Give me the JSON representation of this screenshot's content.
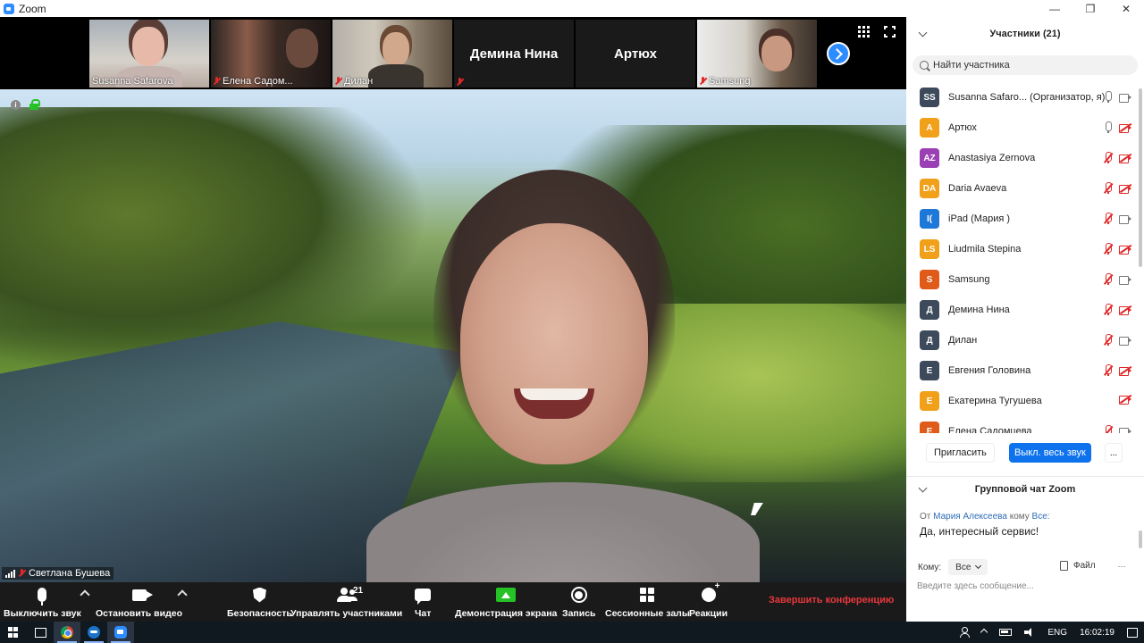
{
  "window": {
    "title": "Zoom",
    "controls": {
      "minimize": "—",
      "maximize": "❐",
      "close": "✕"
    }
  },
  "thumbnails": [
    {
      "name": "Susanna Safarova",
      "muted": false
    },
    {
      "name": "Елена Садом...",
      "muted": true
    },
    {
      "name": "Дилан",
      "muted": true
    },
    {
      "name": "Демина Нина",
      "muted": true,
      "video_off": true
    },
    {
      "name": "Артюх",
      "muted": false,
      "video_off": true
    },
    {
      "name": "Samsung",
      "muted": true
    }
  ],
  "active_speaker": {
    "name": "Светлана Бушева"
  },
  "toolbar": {
    "mute_label": "Выключить звук",
    "video_label": "Остановить видео",
    "security_label": "Безопасность",
    "participants_label": "Управлять участниками",
    "participants_count": "21",
    "chat_label": "Чат",
    "share_label": "Демонстрация экрана",
    "record_label": "Запись",
    "rooms_label": "Сессионные залы",
    "reactions_label": "Реакции",
    "end_label": "Завершить конференцию"
  },
  "participants_panel": {
    "title": "Участники (21)",
    "search_placeholder": "Найти участника",
    "participants": [
      {
        "initials": "SS",
        "name": "Susanna Safaro... (Организатор, я)",
        "color": "#3c4a5c",
        "mic_off": false,
        "cam_off": false
      },
      {
        "initials": "А",
        "name": "Артюх",
        "color": "#f0a019",
        "mic_off": false,
        "cam_off": true
      },
      {
        "initials": "AZ",
        "name": "Anastasiya Zernova",
        "color": "#9b3fb5",
        "mic_off": true,
        "cam_off": true
      },
      {
        "initials": "DA",
        "name": "Daria Avaeva",
        "color": "#f0a019",
        "mic_off": true,
        "cam_off": true
      },
      {
        "initials": "I(",
        "name": "iPad (Мария )",
        "color": "#1e78d7",
        "mic_off": true,
        "cam_off": false
      },
      {
        "initials": "LS",
        "name": "Liudmila Stepina",
        "color": "#f0a019",
        "mic_off": true,
        "cam_off": true
      },
      {
        "initials": "S",
        "name": "Samsung",
        "color": "#e05a1a",
        "mic_off": true,
        "cam_off": false
      },
      {
        "initials": "Д",
        "name": "Демина Нина",
        "color": "#3c4a5c",
        "mic_off": true,
        "cam_off": true
      },
      {
        "initials": "Д",
        "name": "Дилан",
        "color": "#3c4a5c",
        "mic_off": true,
        "cam_off": false
      },
      {
        "initials": "Е",
        "name": "Евгения Головина",
        "color": "#3c4a5c",
        "mic_off": true,
        "cam_off": true
      },
      {
        "initials": "Е",
        "name": "Екатерина Тугушева",
        "color": "#f0a019",
        "mic_off": false,
        "cam_off": true,
        "no_mic": true
      },
      {
        "initials": "Е",
        "name": "Елена Садомцева",
        "color": "#e05a1a",
        "mic_off": true,
        "cam_off": false
      }
    ],
    "invite_label": "Пригласить",
    "mute_all_label": "Выкл. весь звук",
    "more_label": "..."
  },
  "chat_panel": {
    "title": "Групповой чат Zoom",
    "message": {
      "from_prefix": "От",
      "sender": "Мария Алексеева",
      "to_prefix": "кому",
      "recipient": "Все:",
      "text": "Да, интересный сервис!"
    },
    "to_label": "Кому:",
    "to_value": "Все",
    "file_label": "Файл",
    "more_label": "···",
    "input_placeholder": "Введите здесь сообщение..."
  },
  "taskbar": {
    "language": "ENG",
    "time": "16:02:19"
  }
}
